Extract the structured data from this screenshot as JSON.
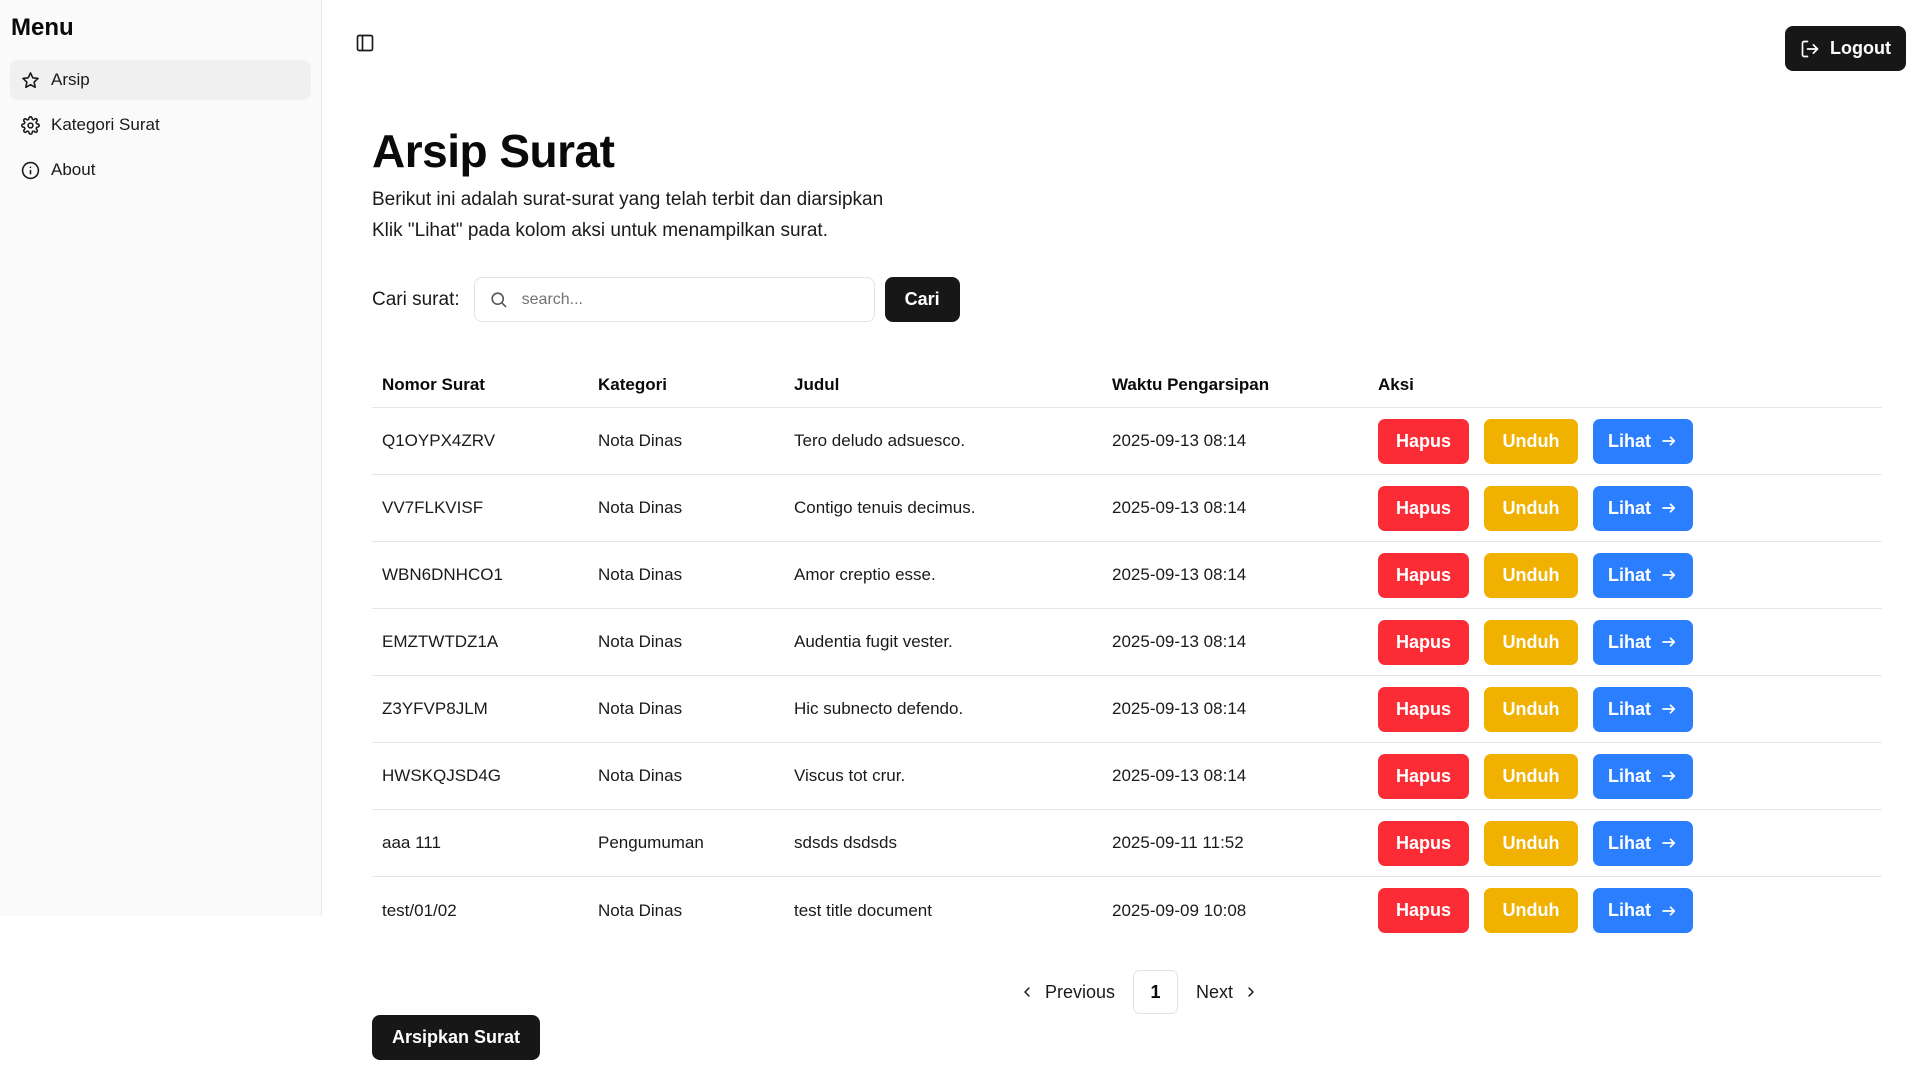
{
  "sidebar": {
    "title": "Menu",
    "items": [
      {
        "label": "Arsip",
        "icon": "star-icon"
      },
      {
        "label": "Kategori Surat",
        "icon": "gear-icon"
      },
      {
        "label": "About",
        "icon": "info-icon"
      }
    ]
  },
  "header": {
    "logout_label": "Logout"
  },
  "page": {
    "title": "Arsip Surat",
    "description_line1": "Berikut ini adalah surat-surat yang telah terbit dan diarsipkan",
    "description_line2": "Klik \"Lihat\" pada kolom aksi untuk menampilkan surat."
  },
  "search": {
    "label": "Cari surat:",
    "placeholder": "search...",
    "value": "",
    "button_label": "Cari"
  },
  "table": {
    "headers": [
      "Nomor Surat",
      "Kategori",
      "Judul",
      "Waktu Pengarsipan",
      "Aksi"
    ],
    "rows": [
      {
        "nomor": "Q1OYPX4ZRV",
        "kategori": "Nota Dinas",
        "judul": "Tero deludo adsuesco.",
        "waktu": "2025-09-13 08:14"
      },
      {
        "nomor": "VV7FLKVISF",
        "kategori": "Nota Dinas",
        "judul": "Contigo tenuis decimus.",
        "waktu": "2025-09-13 08:14"
      },
      {
        "nomor": "WBN6DNHCO1",
        "kategori": "Nota Dinas",
        "judul": "Amor creptio esse.",
        "waktu": "2025-09-13 08:14"
      },
      {
        "nomor": "EMZTWTDZ1A",
        "kategori": "Nota Dinas",
        "judul": "Audentia fugit vester.",
        "waktu": "2025-09-13 08:14"
      },
      {
        "nomor": "Z3YFVP8JLM",
        "kategori": "Nota Dinas",
        "judul": "Hic subnecto defendo.",
        "waktu": "2025-09-13 08:14"
      },
      {
        "nomor": "HWSKQJSD4G",
        "kategori": "Nota Dinas",
        "judul": "Viscus tot crur.",
        "waktu": "2025-09-13 08:14"
      },
      {
        "nomor": "aaa 111",
        "kategori": "Pengumuman",
        "judul": "sdsds dsdsds",
        "waktu": "2025-09-11 11:52"
      },
      {
        "nomor": "test/01/02",
        "kategori": "Nota Dinas",
        "judul": "test title document",
        "waktu": "2025-09-09 10:08"
      }
    ],
    "actions": {
      "hapus": "Hapus",
      "unduh": "Unduh",
      "lihat": "Lihat"
    }
  },
  "pagination": {
    "previous_label": "Previous",
    "current_page": "1",
    "next_label": "Next"
  },
  "footer": {
    "arsipkan_label": "Arsipkan Surat"
  },
  "colors": {
    "hapus": "#fb2c36",
    "unduh": "#f0b100",
    "lihat": "#2b7fff",
    "dark_button": "#171717",
    "sidebar_bg": "#fafafa"
  }
}
